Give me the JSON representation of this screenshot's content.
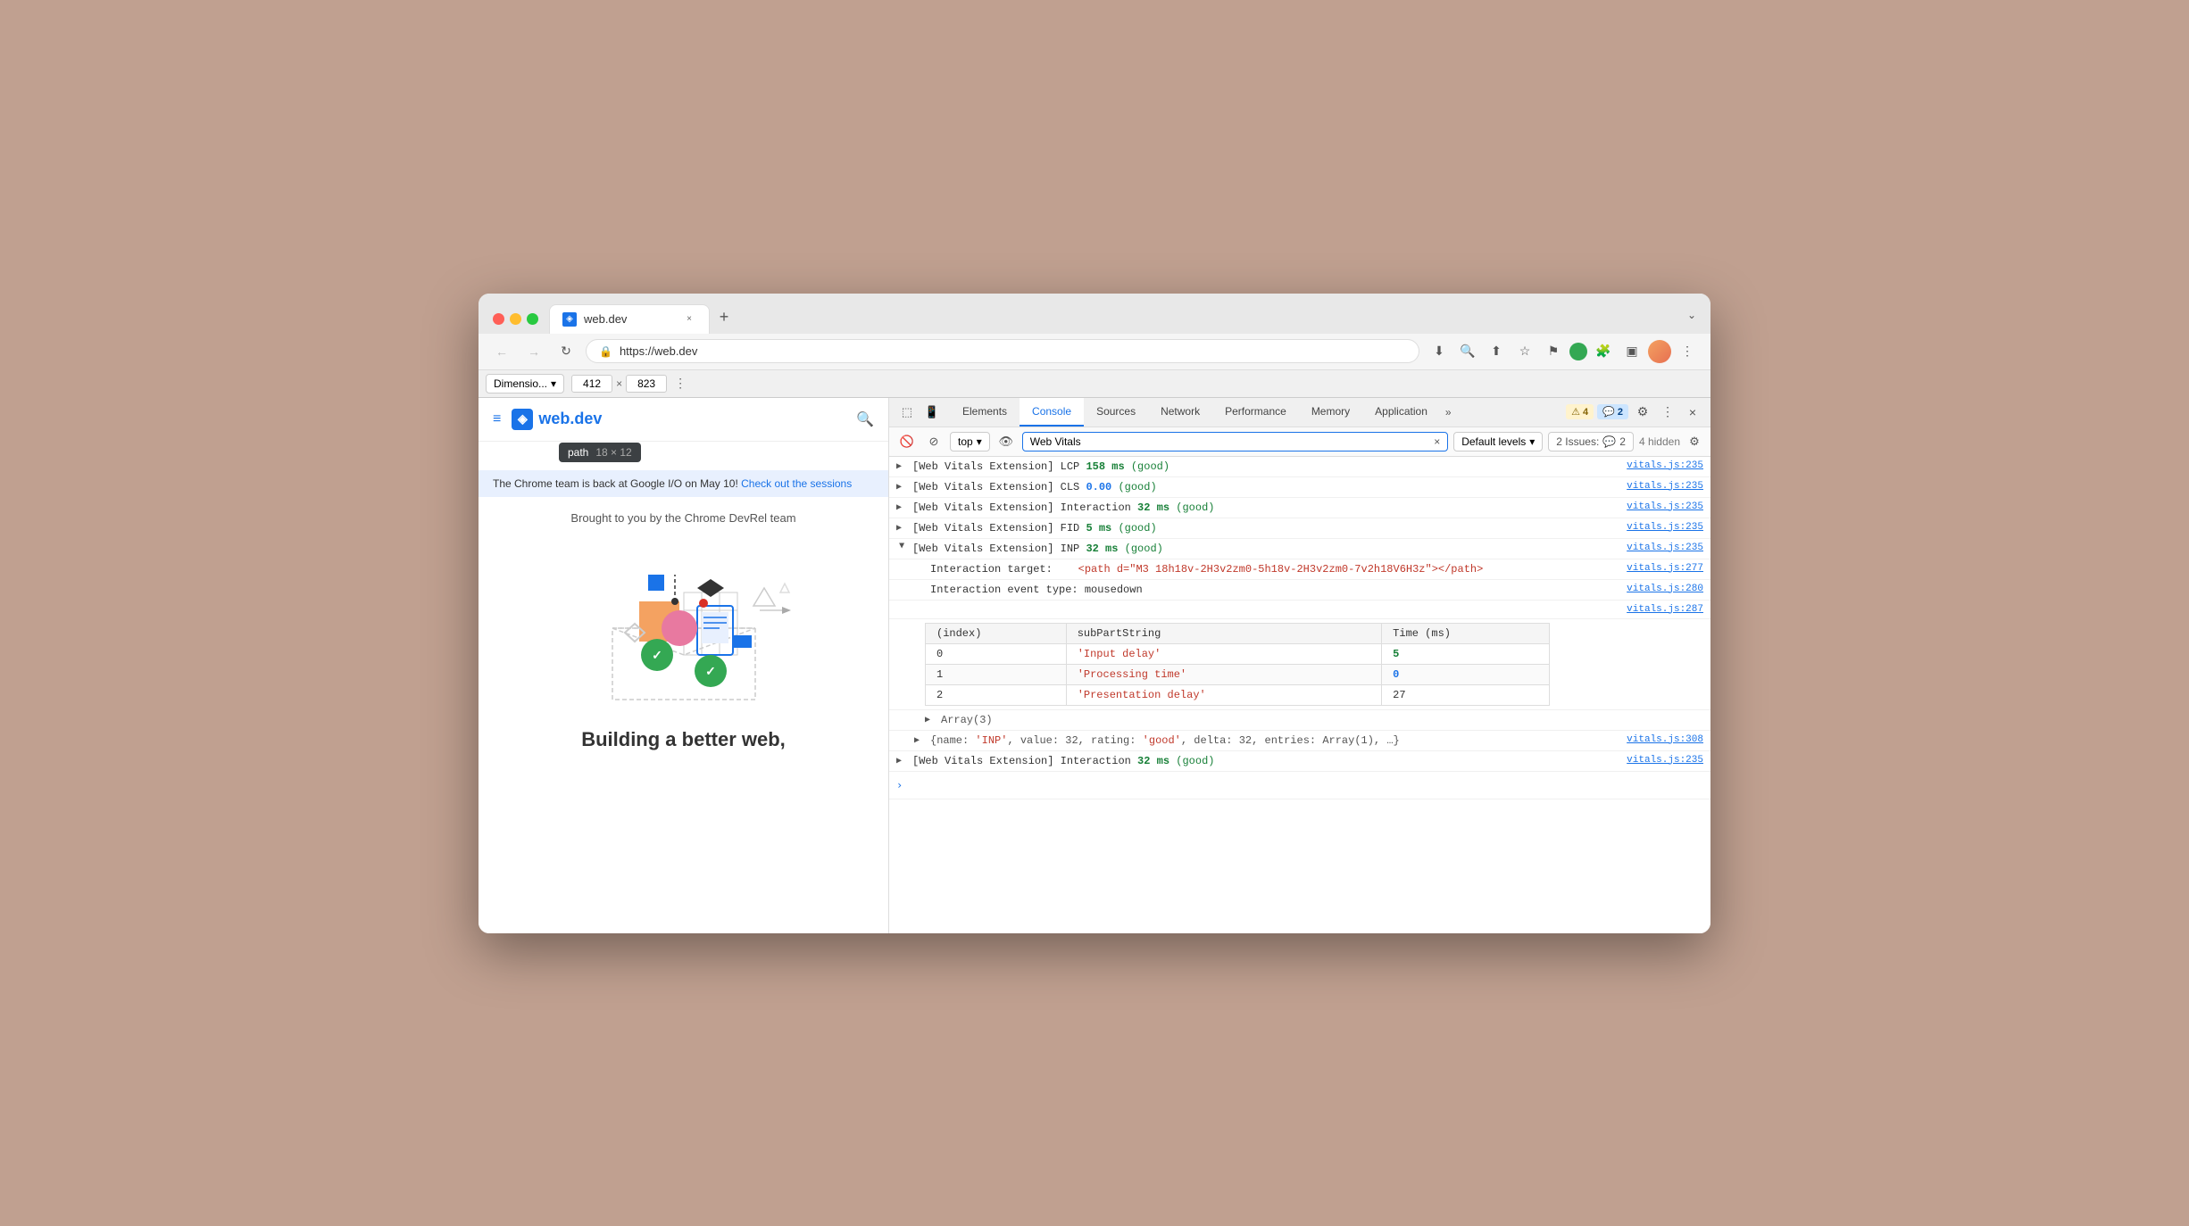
{
  "browser": {
    "tab_title": "web.dev",
    "tab_close": "×",
    "new_tab": "+",
    "tab_chevron": "⌄",
    "nav": {
      "back": "←",
      "forward": "→",
      "refresh": "↻",
      "lock_icon": "🔒",
      "url": "https://web.dev"
    },
    "toolbar": {
      "download": "⬇",
      "zoom": "🔍",
      "share": "⬆",
      "bookmark": "☆",
      "flag": "⚑",
      "green_btn": "■",
      "puzzle": "🧩",
      "layout": "▣",
      "profile": "●",
      "more": "⋮"
    }
  },
  "devtools_bar": {
    "dimension_label": "Dimensio...",
    "width": "412",
    "height": "823",
    "separator": "×",
    "more_btn": "⋮"
  },
  "webpage": {
    "hamburger": "≡",
    "logo_text": "web.dev",
    "search_icon": "🔍",
    "path_label": "path",
    "path_size": "18 × 12",
    "announcement": "The Chrome team is back at Google I/O on May 10!",
    "announcement_link": "Check out the sessions",
    "brought_by": "Brought to you by the Chrome DevRel team",
    "building_text": "Building a better web,"
  },
  "devtools": {
    "panels": [
      "Elements",
      "Console",
      "Sources",
      "Network",
      "Performance",
      "Memory",
      "Application"
    ],
    "active_panel": "Console",
    "more_panels": "»",
    "badges": {
      "warning_count": "4",
      "warning_icon": "⚠",
      "info_count": "2",
      "info_icon": "💬"
    },
    "gear": "⚙",
    "menu": "⋮",
    "close": "×",
    "console_toolbar": {
      "clear": "🚫",
      "top_label": "top",
      "top_arrow": "▾",
      "eye": "👁",
      "search_value": "Web Vitals",
      "clear_search": "×",
      "levels_label": "Default levels",
      "levels_arrow": "▾",
      "issues_label": "2 Issues:",
      "issues_count": "2",
      "hidden_label": "4 hidden",
      "settings_icon": "⚙"
    },
    "console_rows": [
      {
        "type": "collapsed",
        "prefix": "[Web Vitals Extension]",
        "metric": "LCP",
        "value": "158 ms",
        "value_class": "lcp-val",
        "rating": "(good)",
        "rating_class": "good",
        "file": "vitals.js:235"
      },
      {
        "type": "collapsed",
        "prefix": "[Web Vitals Extension]",
        "metric": "CLS",
        "value": "0.00",
        "value_class": "zero-val",
        "rating": "(good)",
        "rating_class": "good",
        "file": "vitals.js:235"
      },
      {
        "type": "collapsed",
        "prefix": "[Web Vitals Extension]",
        "metric": "Interaction",
        "value": "32 ms",
        "value_class": "lcp-val",
        "rating": "(good)",
        "rating_class": "good",
        "file": "vitals.js:235"
      },
      {
        "type": "collapsed",
        "prefix": "[Web Vitals Extension]",
        "metric": "FID",
        "value": "5 ms",
        "value_class": "lcp-val",
        "rating": "(good)",
        "rating_class": "good",
        "file": "vitals.js:235"
      }
    ],
    "expanded_row": {
      "prefix": "[Web Vitals Extension]",
      "metric": "INP",
      "value": "32 ms",
      "value_class": "lcp-val",
      "rating": "(good)",
      "rating_class": "good",
      "file": "vitals.js:235"
    },
    "nested_rows": [
      {
        "label": "Interaction target:",
        "content": "<path d=\"M3 18h18v-2H3v2zm0-5h18v-2H3v2zm0-7v2h18V6H3z\"></path>",
        "content_class": "string-val",
        "file": "vitals.js:277"
      },
      {
        "label": "Interaction event type:",
        "content": "mousedown",
        "content_class": "keyword",
        "file": "vitals.js:280"
      },
      {
        "label": "",
        "content": "",
        "content_class": "",
        "file": "vitals.js:287"
      }
    ],
    "table": {
      "headers": [
        "(index)",
        "subPartString",
        "Time (ms)"
      ],
      "rows": [
        [
          "0",
          "'Input delay'",
          "5"
        ],
        [
          "1",
          "'Processing time'",
          "0"
        ],
        [
          "2",
          "'Presentation delay'",
          "27"
        ]
      ],
      "row_classes": [
        "",
        "string-val",
        "lcp-val"
      ]
    },
    "array_row": "▶ Array(3)",
    "object_row": "▶ {name: 'INP', value: 32, rating: 'good', delta: 32, entries: Array(1), …}",
    "object_file": "vitals.js:308",
    "last_interaction": {
      "prefix": "[Web Vitals Extension]",
      "metric": "Interaction",
      "value": "32 ms",
      "value_class": "lcp-val",
      "rating": "(good)",
      "rating_class": "good",
      "file": "vitals.js:235"
    }
  }
}
